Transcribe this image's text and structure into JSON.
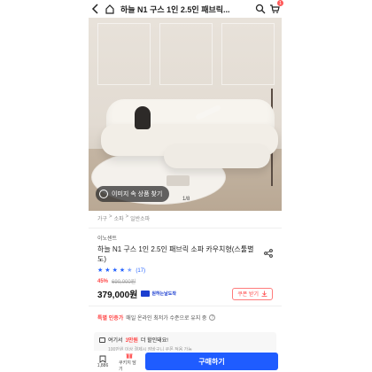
{
  "header": {
    "title": "하늘 N1 구스 1인 2.5인 패브릭...",
    "cart_count": "1",
    "icons": [
      "back-arrow-icon",
      "home-icon",
      "search-icon",
      "cart-icon"
    ]
  },
  "hero": {
    "image_search_label": "이미지 속 상품 찾기",
    "counter": "1/8"
  },
  "breadcrumb": [
    "가구",
    ">",
    "소파",
    ">",
    "일반소파"
  ],
  "product": {
    "brand": "이노센트",
    "name": "하늘 N1 구스 1인 2.5인 패브릭 소파 카우치형(스툴별도)",
    "rating": 4.5,
    "review_count": "(17)",
    "discount": "45%",
    "original_price": "690,000원",
    "price": "379,000원",
    "delivery_label": "원하는날도착",
    "coupon_label": "쿠폰 받기"
  },
  "special": {
    "label": "특별 인증가",
    "text": "매일 온라인 최저가 수준으로 유지 중"
  },
  "benefit": {
    "prefix": "여기서",
    "highlight": "3만원",
    "suffix": "더 할인돼요!",
    "subtext": "100만원 이상 결제시 장바구니 쿠폰 적용 가능"
  },
  "bottom_bar": {
    "save_label": "1,886",
    "gift_label": "쿠키지 담기",
    "buy_label": "구매하기"
  },
  "colors": {
    "accent": "#1f5cff",
    "sale": "#ff4747",
    "star": "#2563ff"
  }
}
